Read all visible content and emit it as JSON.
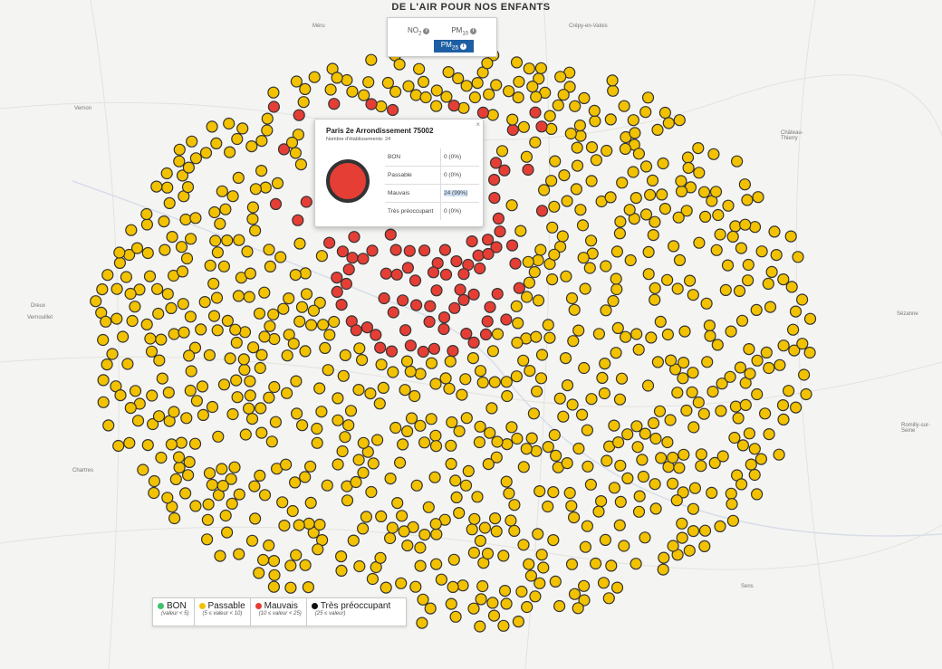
{
  "page_title": "DE L'AIR POUR NOS ENFANTS",
  "pollutants": {
    "no2": "NO",
    "no2_sub": "2",
    "pm10": "PM",
    "pm10_sub": "10",
    "pm25": "PM",
    "pm25_sub": "25",
    "info": "i"
  },
  "popup": {
    "title": "Paris 2e Arrondissement 75002",
    "subtitle": "Nombre d'établissements: 24",
    "close": "×",
    "rows": [
      {
        "label": "BON",
        "value": "0 (0%)"
      },
      {
        "label": "Passable",
        "value": "0 (0%)"
      },
      {
        "label": "Mauvais",
        "value": "24 (99%)"
      },
      {
        "label": "Très préoccupant",
        "value": "0 (0%)"
      }
    ]
  },
  "legend": [
    {
      "label": "BON",
      "range": "(valeur < 5)",
      "color": "#3cc46a"
    },
    {
      "label": "Passable",
      "range": "(5 ≤ valeur < 10)",
      "color": "#f2c200"
    },
    {
      "label": "Mauvais",
      "range": "(10 ≤ valeur < 25)",
      "color": "#e53e35"
    },
    {
      "label": "Très préoccupant",
      "range": "(25 ≤ valeur)",
      "color": "#111111"
    }
  ],
  "place_labels": [
    "Méru",
    "Crépy-en-Valois",
    "Vernon",
    "Château-Thierry",
    "Dreux",
    "Vernouillet",
    "Sézanne",
    "Chartres",
    "Romilly-sur-Seine",
    "Sens"
  ],
  "colors": {
    "good": "#3cc46a",
    "passable": "#f2c200",
    "bad": "#e53e35",
    "very_bad": "#111111",
    "accent": "#1e5fa3"
  }
}
